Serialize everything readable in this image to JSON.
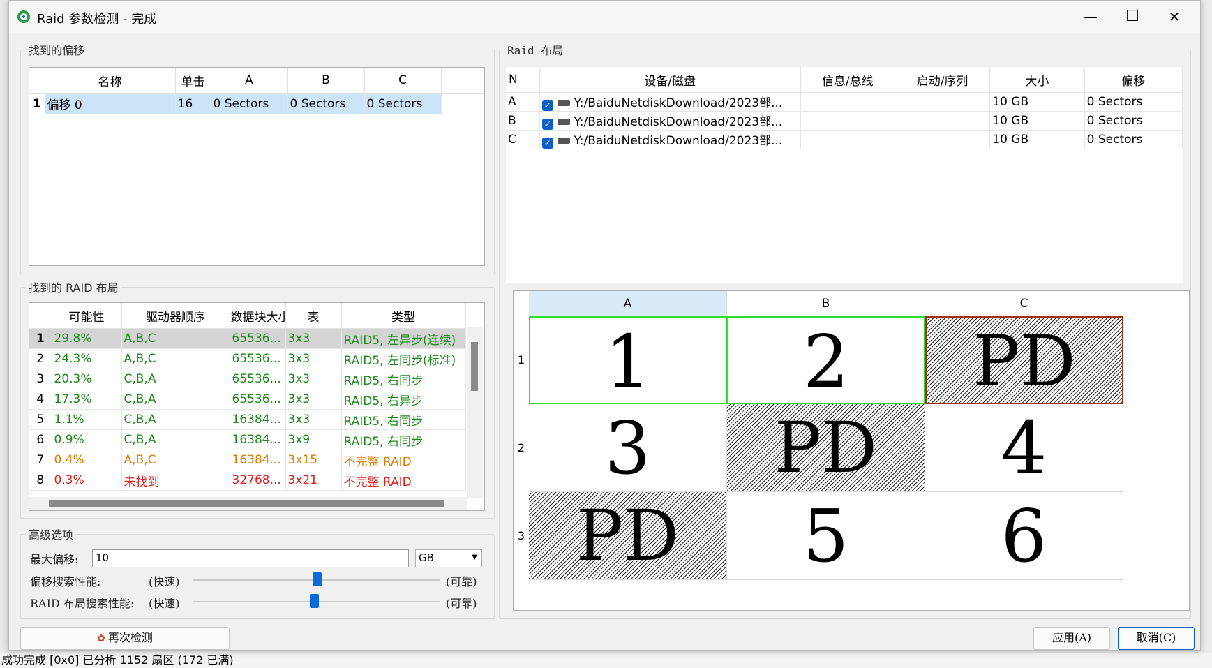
{
  "window": {
    "title": "Raid 参数检测 - 完成",
    "controls": {
      "minimize": "—",
      "maximize": "☐",
      "close": "✕"
    }
  },
  "background": {
    "status_text": "成功完成   [0x0] 已分析 1152 扇区 (172 已满)"
  },
  "offsets_panel": {
    "title": "找到的偏移",
    "columns": [
      "名称",
      "单击",
      "A",
      "B",
      "C"
    ],
    "rows": [
      {
        "n": "1",
        "name": "偏移 0",
        "click": "16",
        "a": "0 Sectors",
        "b": "0 Sectors",
        "c": "0 Sectors"
      }
    ]
  },
  "raid_layouts_panel": {
    "title": "找到的 RAID 布局",
    "columns": [
      "可能性",
      "驱动器顺序",
      "数据块大小",
      "表",
      "类型"
    ],
    "rows": [
      {
        "n": "1",
        "prob": "29.8%",
        "order": "A,B,C",
        "block": "65536...",
        "table": "3x3",
        "type": "RAID5, 左异步(连续)",
        "color": "green"
      },
      {
        "n": "2",
        "prob": "24.3%",
        "order": "A,B,C",
        "block": "65536...",
        "table": "3x3",
        "type": "RAID5, 左同步(标准)",
        "color": "green"
      },
      {
        "n": "3",
        "prob": "20.3%",
        "order": "C,B,A",
        "block": "65536...",
        "table": "3x3",
        "type": "RAID5, 右同步",
        "color": "green"
      },
      {
        "n": "4",
        "prob": "17.3%",
        "order": "C,B,A",
        "block": "65536...",
        "table": "3x3",
        "type": "RAID5, 右异步",
        "color": "green"
      },
      {
        "n": "5",
        "prob": "1.1%",
        "order": "C,B,A",
        "block": "16384...",
        "table": "3x3",
        "type": "RAID5, 右同步",
        "color": "green"
      },
      {
        "n": "6",
        "prob": "0.9%",
        "order": "C,B,A",
        "block": "16384...",
        "table": "3x9",
        "type": "RAID5, 右同步",
        "color": "green"
      },
      {
        "n": "7",
        "prob": "0.4%",
        "order": "A,B,C",
        "block": "16384...",
        "table": "3x15",
        "type": "不完整 RAID",
        "color": "orange"
      },
      {
        "n": "8",
        "prob": "0.3%",
        "order": "未找到",
        "block": "32768...",
        "table": "3x21",
        "type": "不完整 RAID",
        "color": "red"
      }
    ]
  },
  "raid_layout_panel": {
    "title": "Raid 布局",
    "columns": [
      "N",
      "设备/磁盘",
      "信息/总线",
      "启动/序列",
      "大小",
      "偏移"
    ],
    "rows": [
      {
        "n": "A",
        "device": "Y:/BaiduNetdiskDownload/2023部...",
        "info": "",
        "boot": "",
        "size": "10 GB",
        "offset": "0 Sectors"
      },
      {
        "n": "B",
        "device": "Y:/BaiduNetdiskDownload/2023部...",
        "info": "",
        "boot": "",
        "size": "10 GB",
        "offset": "0 Sectors"
      },
      {
        "n": "C",
        "device": "Y:/BaiduNetdiskDownload/2023部...",
        "info": "",
        "boot": "",
        "size": "10 GB",
        "offset": "0 Sectors"
      }
    ]
  },
  "block_grid": {
    "columns": [
      "A",
      "B",
      "C"
    ],
    "rows": [
      "1",
      "2",
      "3"
    ],
    "cells": [
      [
        "1",
        "2",
        "PD"
      ],
      [
        "3",
        "PD",
        "4"
      ],
      [
        "PD",
        "5",
        "6"
      ]
    ]
  },
  "advanced": {
    "title": "高级选项",
    "max_offset_label": "最大偏移:",
    "max_offset_value": "10",
    "unit_selected": "GB",
    "offset_perf_label": "偏移搜索性能:",
    "raid_perf_label": "RAID 布局搜索性能:",
    "fast_label": "(快速)",
    "reliable_label": "(可靠)",
    "offset_perf_value": 0.5,
    "raid_perf_value": 0.49
  },
  "buttons": {
    "redetect": "再次检测",
    "apply": "应用(A)",
    "cancel": "取消(C)"
  },
  "colors": {
    "selected_row": "#cce4f7",
    "green_text": "#1a8a1a",
    "orange_text": "#e07a00",
    "red_text": "#e02020",
    "accent": "#0a6ad8"
  }
}
